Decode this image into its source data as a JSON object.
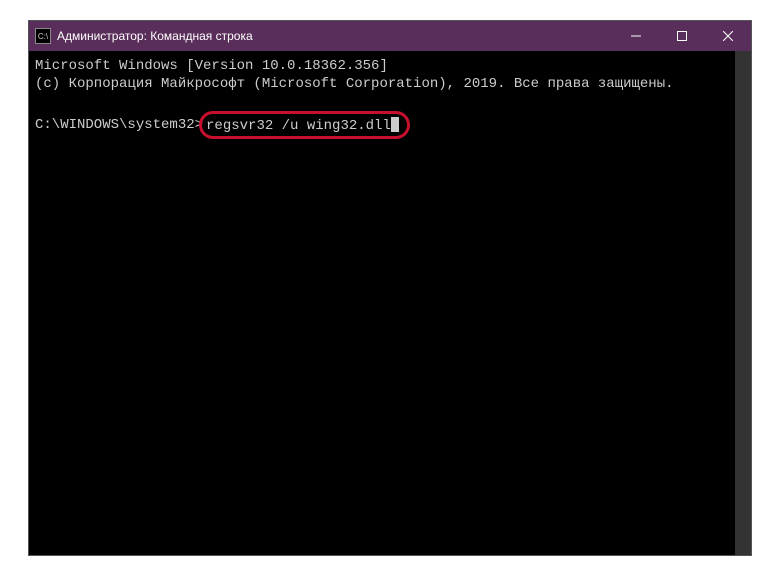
{
  "titlebar": {
    "title": "Администратор: Командная строка",
    "icon_glyph": "C:\\"
  },
  "terminal": {
    "line1": "Microsoft Windows [Version 10.0.18362.356]",
    "line2": "(c) Корпорация Майкрософт (Microsoft Corporation), 2019. Все права защищены.",
    "prompt": "C:\\WINDOWS\\system32>",
    "command": "regsvr32 /u wing32.dll"
  }
}
